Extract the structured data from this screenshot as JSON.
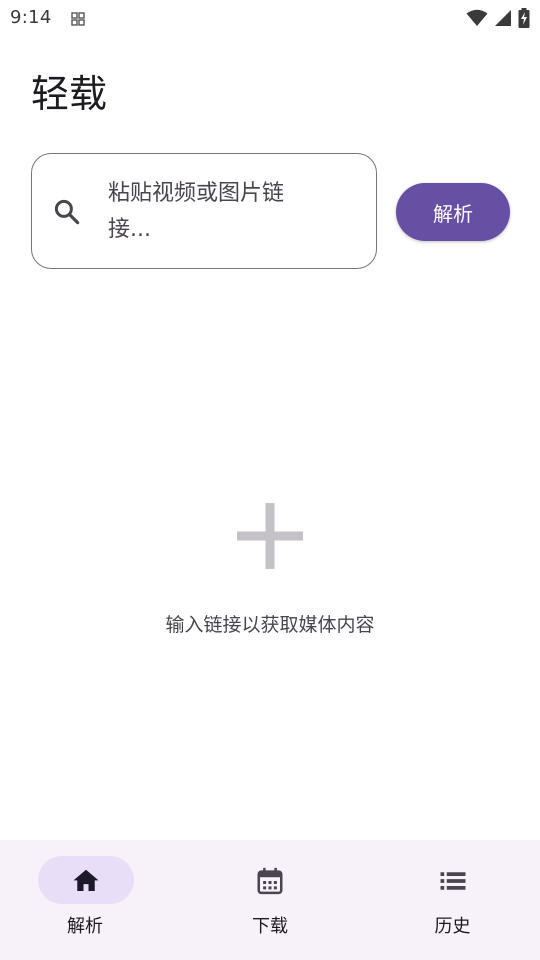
{
  "status_bar": {
    "time": "9:14"
  },
  "app": {
    "title": "轻载"
  },
  "search": {
    "placeholder": "粘贴视频或图片链接..."
  },
  "parse_button": {
    "label": "解析"
  },
  "empty_state": {
    "icon": "plus-icon",
    "message": "输入链接以获取媒体内容"
  },
  "bottom_nav": {
    "items": [
      {
        "label": "解析",
        "icon": "home-icon",
        "active": true
      },
      {
        "label": "下载",
        "icon": "calendar-icon",
        "active": false
      },
      {
        "label": "历史",
        "icon": "list-icon",
        "active": false
      }
    ]
  },
  "colors": {
    "primary": "#6750a4",
    "nav_background": "#f7f2fa",
    "active_indicator": "#e8def8",
    "outline": "#79747e",
    "plus_icon": "#c4c2c6"
  }
}
